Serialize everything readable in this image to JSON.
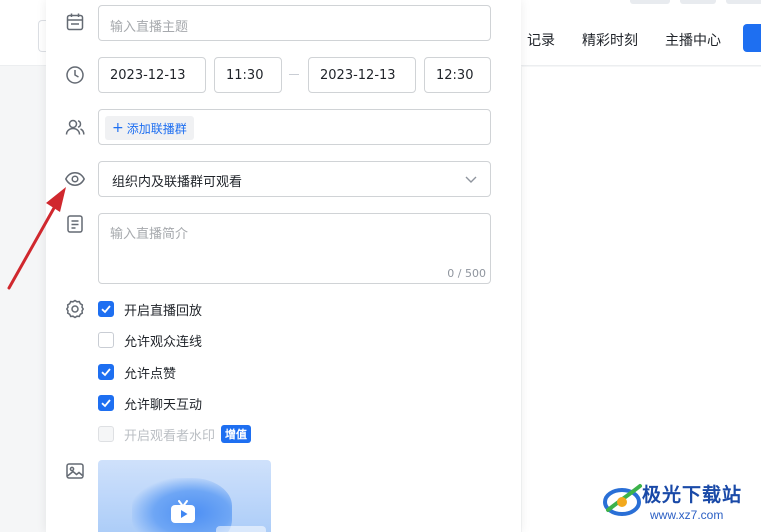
{
  "background": {
    "nav_items": [
      "记录",
      "精彩时刻",
      "主播中心"
    ]
  },
  "form": {
    "title_placeholder": "输入直播主题",
    "start_date": "2023-12-13",
    "start_time": "11:30",
    "end_date": "2023-12-13",
    "end_time": "12:30",
    "add_group_label": "添加联播群",
    "visibility_value": "组织内及联播群可观看",
    "intro_placeholder": "输入直播简介",
    "intro_counter": "0 / 500",
    "options": [
      {
        "label": "开启直播回放",
        "checked": true,
        "disabled": false
      },
      {
        "label": "允许观众连线",
        "checked": false,
        "disabled": false
      },
      {
        "label": "允许点赞",
        "checked": true,
        "disabled": false
      },
      {
        "label": "允许聊天互动",
        "checked": true,
        "disabled": false
      },
      {
        "label": "开启观看者水印",
        "checked": false,
        "disabled": true
      }
    ],
    "watermark_badge": "增值"
  },
  "icons": {
    "title_row": "calendar-icon",
    "time_row": "clock-icon",
    "group_row": "users-icon",
    "visibility_row": "eye-icon",
    "intro_row": "document-icon",
    "settings_row": "gear-icon",
    "cover_row": "image-icon"
  },
  "site_watermark": {
    "name": "极光下载站",
    "url": "www.xz7.com"
  },
  "colors": {
    "accent": "#1e6ff1",
    "arrow": "#d0282e"
  }
}
